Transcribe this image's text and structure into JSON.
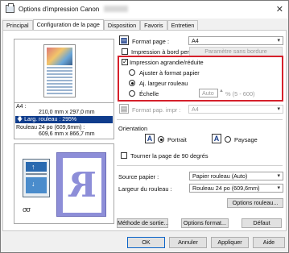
{
  "window": {
    "title": "Options d'impression Canon",
    "close_glyph": "✕"
  },
  "tabs": [
    {
      "label": "Principal"
    },
    {
      "label": "Configuration de la page"
    },
    {
      "label": "Disposition"
    },
    {
      "label": "Favoris"
    },
    {
      "label": "Entretien"
    }
  ],
  "preview": {
    "paper_size": "A4 :",
    "paper_dims": "210,0 mm x 297,0 mm",
    "roll_width_highlight": "Larg. rouleau : 295%",
    "roll_paper": "Rouleau 24 po (609,6mm) :",
    "roll_dims": "609,6 mm x 866,7 mm",
    "roll_icon": "σσ",
    "mirror_letter": "R"
  },
  "page_setup": {
    "format_label": "Format page :",
    "format_value": "A4",
    "borderless_label": "Impression à bord perdu",
    "borderless_checked": false,
    "borderless_btn": "Paramètre sans bordure",
    "enlarge_label": "Impression agrandie/réduite",
    "enlarge_checked": true,
    "fit_paper_label": "Ajuster à format papier",
    "fit_roll_label": "Aj. largeur rouleau",
    "scale_label": "Échelle",
    "scale_value": "Auto",
    "scale_range": "% (5 - 600)",
    "paper_format_label": "Format pap. impr :",
    "paper_format_value": "A4"
  },
  "orientation": {
    "group_label": "Orientation",
    "portrait_label": "Portrait",
    "landscape_label": "Paysage",
    "rotate_label": "Tourner la page de 90 degrés"
  },
  "source": {
    "source_label": "Source papier :",
    "source_value": "Papier rouleau (Auto)",
    "roll_width_label": "Largeur du rouleau :",
    "roll_width_value": "Rouleau 24 po (609,6mm)",
    "roll_options_btn": "Options rouleau..."
  },
  "actions": {
    "output_method": "Méthode de sortie...",
    "format_options": "Options format...",
    "default": "Défaut"
  },
  "footer": {
    "ok": "OK",
    "cancel": "Annuler",
    "apply": "Appliquer",
    "help": "Aide"
  },
  "colors": {
    "highlight_blue": "#0f3c8c",
    "callout_red": "#d5202b",
    "mirror_purple": "#8d8ed8"
  }
}
